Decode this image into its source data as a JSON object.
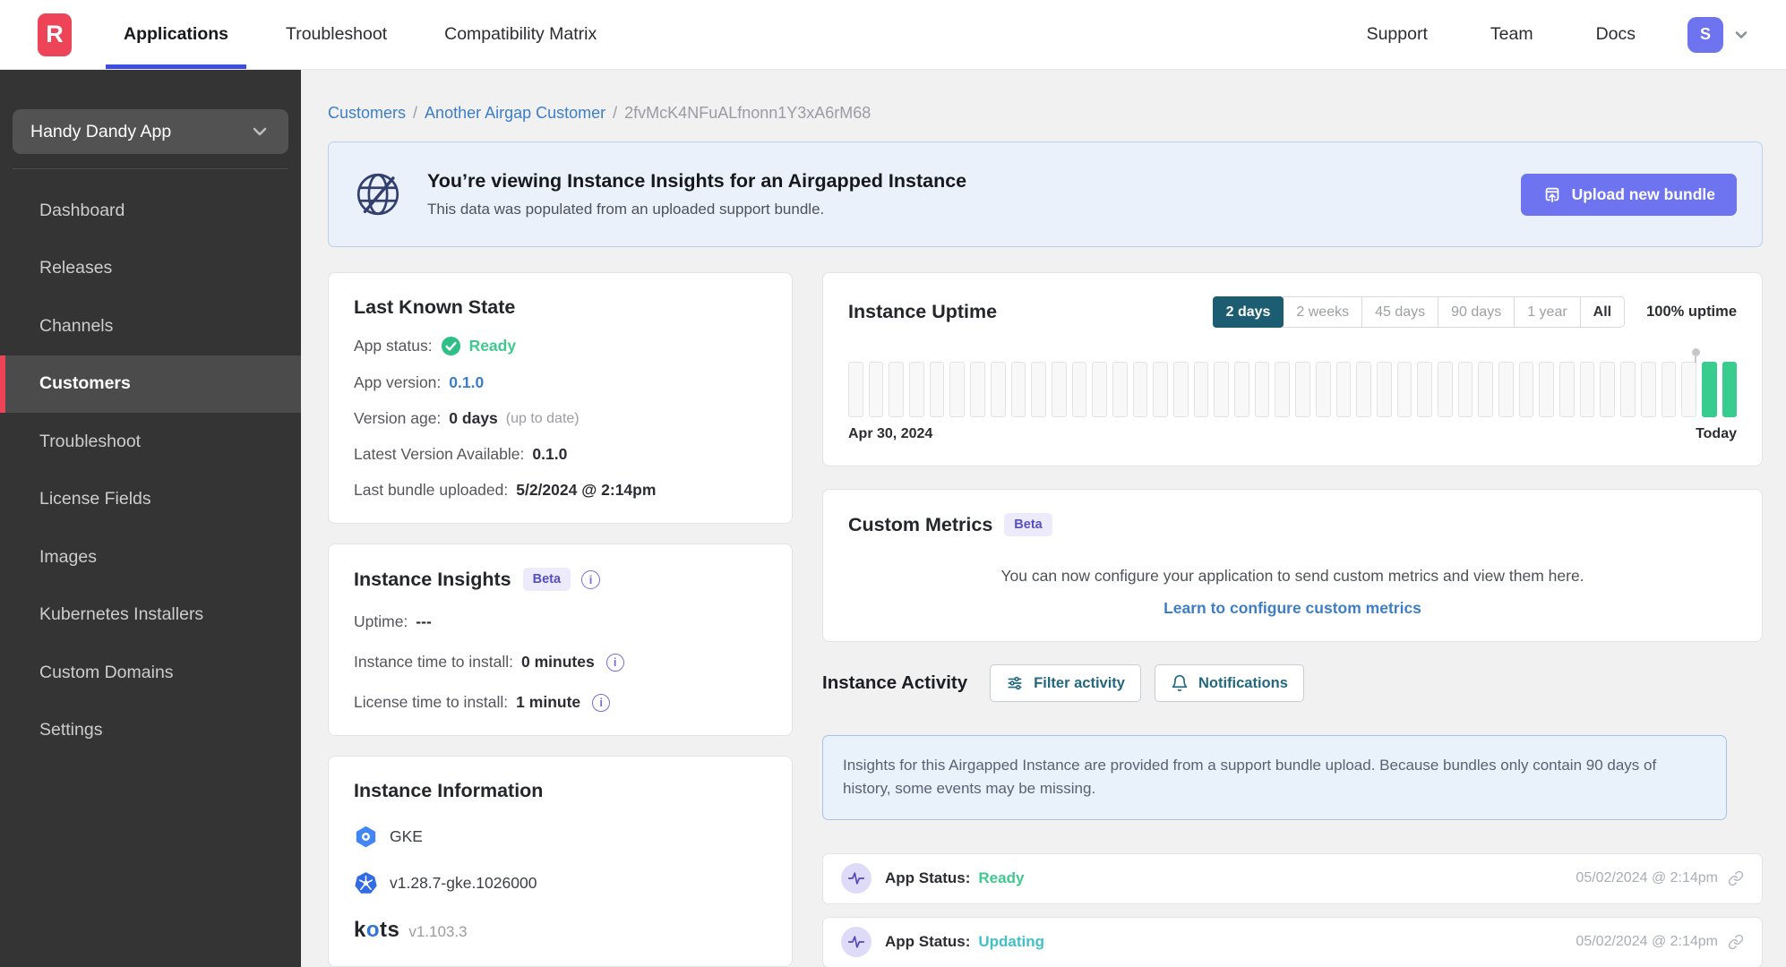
{
  "colors": {
    "accent_red": "#ee4457",
    "indigo": "#6e74f0",
    "indigo_underline": "#3e4ee0",
    "link_blue": "#3d7ec7",
    "green": "#38c48e",
    "teal": "#3fc3c8",
    "button_teal": "#23687f",
    "range_active": "#1d5d72",
    "badge_bg": "#edebfb",
    "badge_text": "#564fc0",
    "banner_bg": "#eaf1fb",
    "banner_border": "#bcd0ec",
    "sidebar_bg": "#343434",
    "sidebar_active": "#4b4b4b"
  },
  "icons": {
    "logo": "replicated-R",
    "chevron_down": "chevron-down",
    "globe_slash": "airgapped-globe",
    "upload": "upload-bundle",
    "check_circle": "status-check",
    "info": "info-circle",
    "gke": "gke-hexagon",
    "kubernetes": "kubernetes-wheel",
    "filter": "filter-sliders",
    "bell": "notifications-bell",
    "pulse": "activity-pulse",
    "link": "permalink-chain"
  },
  "header": {
    "logo_letter": "R",
    "nav": [
      {
        "label": "Applications",
        "active": true
      },
      {
        "label": "Troubleshoot",
        "active": false
      },
      {
        "label": "Compatibility Matrix",
        "active": false
      }
    ],
    "nav_right": [
      {
        "label": "Support"
      },
      {
        "label": "Team"
      },
      {
        "label": "Docs"
      }
    ],
    "avatar_letter": "S"
  },
  "sidebar": {
    "app_selector": "Handy Dandy App",
    "items": [
      {
        "label": "Dashboard",
        "active": false
      },
      {
        "label": "Releases",
        "active": false
      },
      {
        "label": "Channels",
        "active": false
      },
      {
        "label": "Customers",
        "active": true
      },
      {
        "label": "Troubleshoot",
        "active": false
      },
      {
        "label": "License Fields",
        "active": false
      },
      {
        "label": "Images",
        "active": false
      },
      {
        "label": "Kubernetes Installers",
        "active": false
      },
      {
        "label": "Custom Domains",
        "active": false
      },
      {
        "label": "Settings",
        "active": false
      }
    ]
  },
  "breadcrumb": {
    "links": [
      "Customers",
      "Another Airgap Customer"
    ],
    "separator": "/",
    "current": "2fvMcK4NFuALfnonn1Y3xA6rM68"
  },
  "banner": {
    "title": "You’re viewing Instance Insights for an Airgapped Instance",
    "subtitle": "This data was populated from an uploaded support bundle.",
    "button": "Upload new bundle"
  },
  "last_known_state": {
    "title": "Last Known State",
    "rows": [
      {
        "label": "App status:",
        "value": "Ready",
        "color": "#3fc98f"
      },
      {
        "label": "App version:",
        "value": "0.1.0"
      },
      {
        "label": "Version age:",
        "value": "0 days",
        "suffix": "(up to date)"
      },
      {
        "label": "Latest Version Available:",
        "value": "0.1.0"
      },
      {
        "label": "Last bundle uploaded:",
        "value": "5/2/2024 @ 2:14pm"
      }
    ]
  },
  "instance_insights": {
    "title": "Instance Insights",
    "badge": "Beta",
    "info_glyph": "i",
    "rows": [
      {
        "label": "Uptime:",
        "value": "---",
        "info": false
      },
      {
        "label": "Instance time to install:",
        "value": "0 minutes",
        "info": true
      },
      {
        "label": "License time to install:",
        "value": "1 minute",
        "info": true
      }
    ]
  },
  "instance_information": {
    "title": "Instance Information",
    "rows": [
      {
        "icon": "gke-icon",
        "text": "GKE"
      },
      {
        "icon": "kubernetes-icon",
        "text": "v1.28.7-gke.1026000"
      }
    ],
    "kots_logo": {
      "pre": "k",
      "o": "o",
      "post": "ts"
    },
    "kots_version": "v1.103.3"
  },
  "uptime_card": {
    "title": "Instance Uptime",
    "ranges": [
      {
        "label": "2 days",
        "active": true
      },
      {
        "label": "2 weeks",
        "active": false
      },
      {
        "label": "45 days",
        "active": false
      },
      {
        "label": "90 days",
        "active": false
      },
      {
        "label": "1 year",
        "active": false
      },
      {
        "label": "All",
        "active": false,
        "emphasis": true
      }
    ],
    "uptime_label": "100% uptime"
  },
  "chart_data": {
    "type": "bar",
    "title": "Instance Uptime",
    "x_start_label": "Apr 30, 2024",
    "x_end_label": "Today",
    "total_bars": 44,
    "series": [
      {
        "name": "no data",
        "count": 42,
        "color": "#f8f8f9",
        "border": "#e2e3e5"
      },
      {
        "name": "up",
        "count": 2,
        "color": "#38cc8e",
        "border": "#38cc8e"
      }
    ],
    "marker_bar_index": 42,
    "uptime_percent": 100,
    "selected_range": "2 days"
  },
  "custom_metrics": {
    "title": "Custom Metrics",
    "badge": "Beta",
    "body": "You can now configure your application to send custom metrics and view them here.",
    "link": "Learn to configure custom metrics"
  },
  "activity": {
    "title": "Instance Activity",
    "filter_button": "Filter activity",
    "notifications_button": "Notifications",
    "notice": "Insights for this Airgapped Instance are provided from a support bundle upload. Because bundles only contain 90 days of history, some events may be missing.",
    "events": [
      {
        "label": "App Status:",
        "value": "Ready",
        "color": "#3fc98f",
        "timestamp": "05/02/2024 @ 2:14pm"
      },
      {
        "label": "App Status:",
        "value": "Updating",
        "color": "#41c1c6",
        "timestamp": "05/02/2024 @ 2:14pm"
      }
    ]
  }
}
